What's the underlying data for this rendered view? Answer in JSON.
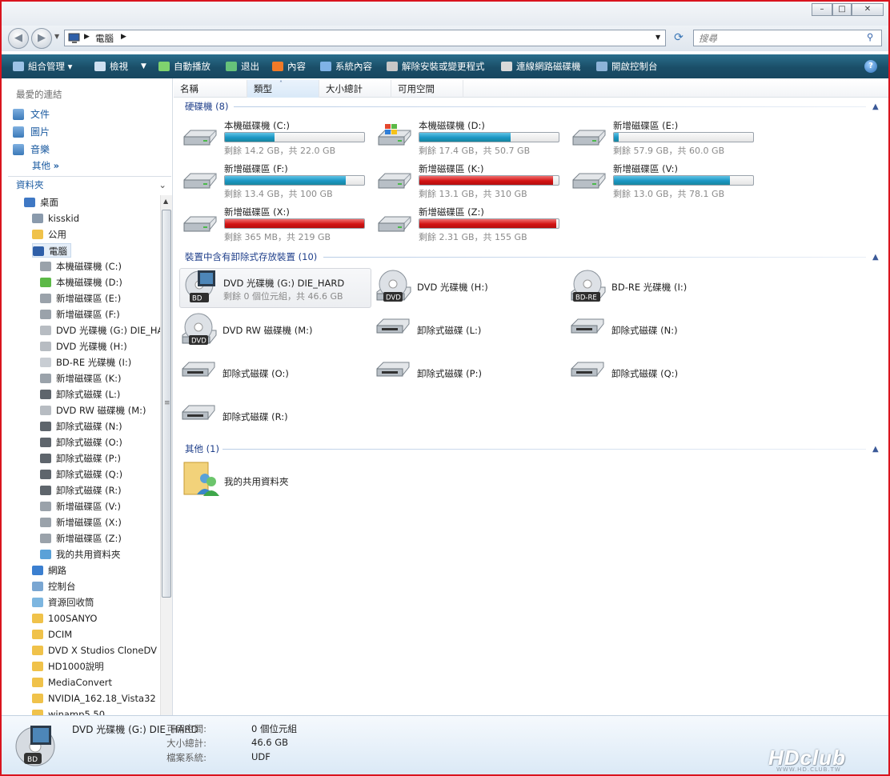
{
  "address": {
    "path": "電腦",
    "search_placeholder": "搜尋"
  },
  "window_controls": {
    "minimize": "–",
    "maximize": "□",
    "close": "✕"
  },
  "toolbar": [
    {
      "label": "組合管理",
      "icon": "organize-icon",
      "dropdown": true
    },
    {
      "label": "檢視",
      "icon": "views-icon",
      "dropdown": true
    },
    {
      "label": "自動播放",
      "icon": "autoplay-icon"
    },
    {
      "label": "退出",
      "icon": "eject-icon"
    },
    {
      "label": "內容",
      "icon": "properties-icon"
    },
    {
      "label": "系統內容",
      "icon": "system-properties-icon"
    },
    {
      "label": "解除安裝或變更程式",
      "icon": "uninstall-icon"
    },
    {
      "label": "連線網路磁碟機",
      "icon": "map-drive-icon"
    },
    {
      "label": "開啟控制台",
      "icon": "control-panel-icon"
    }
  ],
  "favorites": {
    "header": "最愛的連結",
    "items": [
      "文件",
      "圖片",
      "音樂"
    ],
    "more": "其他",
    "more_glyph": "»"
  },
  "folders": {
    "header": "資料夾",
    "tree": [
      {
        "label": "桌面",
        "level": 1,
        "icon": "desktop-icon"
      },
      {
        "label": "kisskid",
        "level": 2,
        "icon": "user-icon"
      },
      {
        "label": "公用",
        "level": 2,
        "icon": "folder-icon"
      },
      {
        "label": "電腦",
        "level": 2,
        "icon": "computer-icon",
        "selected": true
      },
      {
        "label": "本機磁碟機 (C:)",
        "level": 3,
        "icon": "hard-drive-icon"
      },
      {
        "label": "本機磁碟機 (D:)",
        "level": 3,
        "icon": "windows-drive-icon"
      },
      {
        "label": "新增磁碟區 (E:)",
        "level": 3,
        "icon": "hard-drive-icon"
      },
      {
        "label": "新增磁碟區 (F:)",
        "level": 3,
        "icon": "hard-drive-icon"
      },
      {
        "label": "DVD 光碟機 (G:) DIE_HA",
        "level": 3,
        "icon": "dvd-icon"
      },
      {
        "label": "DVD 光碟機 (H:)",
        "level": 3,
        "icon": "dvd-icon"
      },
      {
        "label": "BD-RE 光碟機 (I:)",
        "level": 3,
        "icon": "disc-icon"
      },
      {
        "label": "新增磁碟區 (K:)",
        "level": 3,
        "icon": "hard-drive-icon"
      },
      {
        "label": "卸除式磁碟 (L:)",
        "level": 3,
        "icon": "removable-drive-icon"
      },
      {
        "label": "DVD RW 磁碟機 (M:)",
        "level": 3,
        "icon": "dvd-icon"
      },
      {
        "label": "卸除式磁碟 (N:)",
        "level": 3,
        "icon": "removable-drive-icon"
      },
      {
        "label": "卸除式磁碟 (O:)",
        "level": 3,
        "icon": "removable-drive-icon"
      },
      {
        "label": "卸除式磁碟 (P:)",
        "level": 3,
        "icon": "removable-drive-icon"
      },
      {
        "label": "卸除式磁碟 (Q:)",
        "level": 3,
        "icon": "removable-drive-icon"
      },
      {
        "label": "卸除式磁碟 (R:)",
        "level": 3,
        "icon": "removable-drive-icon"
      },
      {
        "label": "新增磁碟區 (V:)",
        "level": 3,
        "icon": "hard-drive-icon"
      },
      {
        "label": "新增磁碟區 (X:)",
        "level": 3,
        "icon": "hard-drive-icon"
      },
      {
        "label": "新增磁碟區 (Z:)",
        "level": 3,
        "icon": "hard-drive-icon"
      },
      {
        "label": "我的共用資料夾",
        "level": 3,
        "icon": "shared-folder-icon"
      },
      {
        "label": "網路",
        "level": 2,
        "icon": "network-icon"
      },
      {
        "label": "控制台",
        "level": 2,
        "icon": "control-panel-icon"
      },
      {
        "label": "資源回收筒",
        "level": 2,
        "icon": "recycle-bin-icon"
      },
      {
        "label": "100SANYO",
        "level": 2,
        "icon": "folder-icon"
      },
      {
        "label": "DCIM",
        "level": 2,
        "icon": "folder-icon"
      },
      {
        "label": "DVD X Studios CloneDV",
        "level": 2,
        "icon": "folder-icon"
      },
      {
        "label": "HD1000說明",
        "level": 2,
        "icon": "folder-icon"
      },
      {
        "label": "MediaConvert",
        "level": 2,
        "icon": "folder-icon"
      },
      {
        "label": "NVIDIA_162.18_Vista32",
        "level": 2,
        "icon": "folder-icon"
      },
      {
        "label": "winamp5.50",
        "level": 2,
        "icon": "folder-icon"
      }
    ]
  },
  "columns": [
    "名稱",
    "類型",
    "大小總計",
    "可用空間"
  ],
  "groups": {
    "hdd": {
      "title": "硬碟機 (8)",
      "drives": [
        {
          "name": "本機磁碟機 (C:)",
          "free": "剩餘 14.2 GB，共 22.0 GB",
          "used": 0.355,
          "color": "blue",
          "icon": "hard-drive-icon"
        },
        {
          "name": "本機磁碟機 (D:)",
          "free": "剩餘 17.4 GB，共 50.7 GB",
          "used": 0.657,
          "color": "blue",
          "icon": "windows-drive-icon"
        },
        {
          "name": "新增磁碟區 (E:)",
          "free": "剩餘 57.9 GB，共 60.0 GB",
          "used": 0.035,
          "color": "blue",
          "icon": "hard-drive-icon"
        },
        {
          "name": "新增磁碟區 (F:)",
          "free": "剩餘 13.4 GB，共 100 GB",
          "used": 0.866,
          "color": "blue",
          "icon": "hard-drive-icon"
        },
        {
          "name": "新增磁碟區 (K:)",
          "free": "剩餘 13.1 GB，共 310 GB",
          "used": 0.958,
          "color": "red",
          "icon": "hard-drive-icon"
        },
        {
          "name": "新增磁碟區 (V:)",
          "free": "剩餘 13.0 GB，共 78.1 GB",
          "used": 0.834,
          "color": "blue",
          "icon": "hard-drive-icon"
        },
        {
          "name": "新增磁碟區 (X:)",
          "free": "剩餘 365 MB，共 219 GB",
          "used": 0.998,
          "color": "red",
          "icon": "hard-drive-icon"
        },
        {
          "name": "新增磁碟區 (Z:)",
          "free": "剩餘 2.31 GB，共 155 GB",
          "used": 0.985,
          "color": "red",
          "icon": "hard-drive-icon"
        }
      ]
    },
    "removable": {
      "title": "裝置中含有卸除式存放裝置 (10)",
      "drives": [
        {
          "name": "DVD 光碟機 (G:) DIE_HARD",
          "free": "剩餘 0 個位元組，共 46.6 GB",
          "icon": "bd-movie-icon",
          "selected": true,
          "badge": "BD"
        },
        {
          "name": "DVD 光碟機 (H:)",
          "icon": "dvd-drive-icon",
          "badge": "DVD"
        },
        {
          "name": "BD-RE 光碟機 (I:)",
          "icon": "bd-re-icon",
          "badge": "BD-RE"
        },
        {
          "name": "DVD RW 磁碟機 (M:)",
          "icon": "dvd-drive-icon",
          "badge": "DVD"
        },
        {
          "name": "卸除式磁碟 (L:)",
          "icon": "removable-drive-icon"
        },
        {
          "name": "卸除式磁碟 (N:)",
          "icon": "removable-drive-icon"
        },
        {
          "name": "卸除式磁碟 (O:)",
          "icon": "removable-drive-icon"
        },
        {
          "name": "卸除式磁碟 (P:)",
          "icon": "removable-drive-icon"
        },
        {
          "name": "卸除式磁碟 (Q:)",
          "icon": "removable-drive-icon"
        },
        {
          "name": "卸除式磁碟 (R:)",
          "icon": "removable-drive-icon"
        }
      ]
    },
    "other": {
      "title": "其他 (1)",
      "items": [
        {
          "name": "我的共用資料夾",
          "icon": "shared-folder-icon"
        }
      ]
    }
  },
  "details": {
    "name": "DVD 光碟機 (G:) DIE_HARD",
    "badge": "BD",
    "free_label": "可用空間:",
    "free_value": "0 個位元組",
    "total_label": "大小總計:",
    "total_value": "46.6 GB",
    "fs_label": "檔案系統:",
    "fs_value": "UDF"
  },
  "watermark": {
    "text": "HDclub",
    "sub": "WWW.HD.CLUB.TW"
  },
  "colors": {
    "bar_blue": "#1b95c3",
    "bar_red": "#d31414",
    "toolbar": "#1a4e68",
    "group_title": "#1e3e8a"
  }
}
